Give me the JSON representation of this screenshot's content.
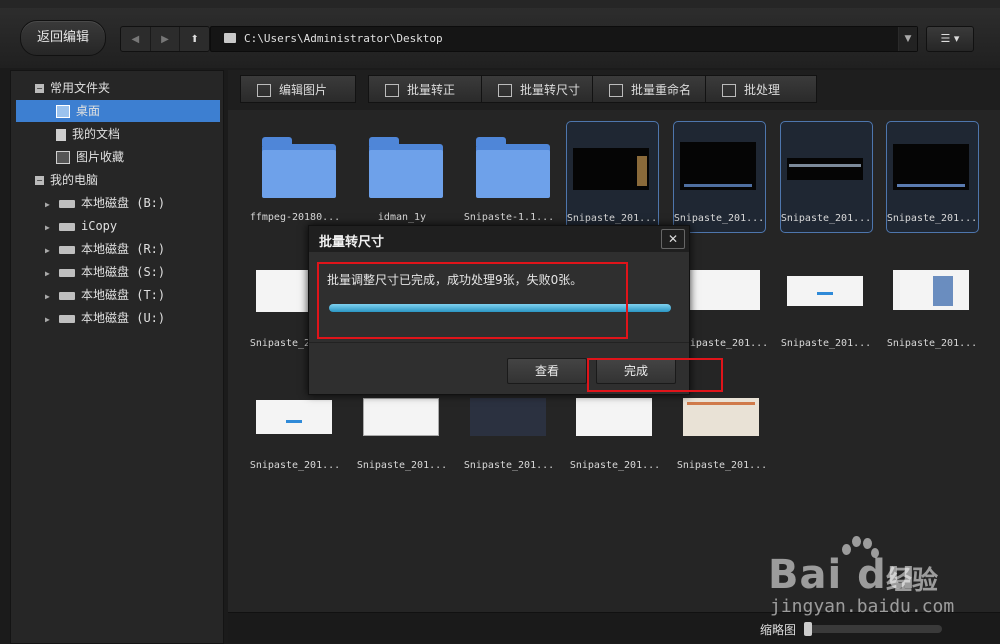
{
  "toolbar": {
    "back_label": "返回编辑",
    "path": "C:\\Users\\Administrator\\Desktop"
  },
  "sidebar": {
    "favorites": "常用文件夹",
    "desktop": "桌面",
    "documents": "我的文档",
    "pictures": "图片收藏",
    "computer": "我的电脑",
    "drives": [
      "本地磁盘 (B:)",
      "iCopy",
      "本地磁盘 (R:)",
      "本地磁盘 (S:)",
      "本地磁盘 (T:)",
      "本地磁盘 (U:)"
    ]
  },
  "actions": {
    "edit": "编辑图片",
    "rotate": "批量转正",
    "resize": "批量转尺寸",
    "rename": "批量重命名",
    "batch": "批处理"
  },
  "files": [
    "ffmpeg-20180...",
    "idman_1y",
    "Snipaste-1.1...",
    "Snipaste_201...",
    "Snipaste_201...",
    "Snipaste_201...",
    "Snipaste_201...",
    "Snipaste_201...",
    "Snipaste_201...",
    "Snipaste_201...",
    "Snipaste_201...",
    "Snipaste_201...",
    "Snipaste_201...",
    "Snipaste_201...",
    "Snipaste_201...",
    "Snipaste_201..."
  ],
  "dialog": {
    "title": "批量转尺寸",
    "message": "批量调整尺寸已完成，成功处理9张，失败0张。",
    "progress": 1.0,
    "view_label": "查看",
    "done_label": "完成"
  },
  "status": {
    "zoom_label": "缩略图",
    "zoom_level": 0.0
  },
  "watermark": {
    "logo": "Bai du",
    "brand_cn": "经验",
    "url": "jingyan.baidu.com"
  },
  "colors": {
    "accent": "#3d7fd1",
    "highlight": "#e0141a",
    "progress": "#2b96c4"
  }
}
